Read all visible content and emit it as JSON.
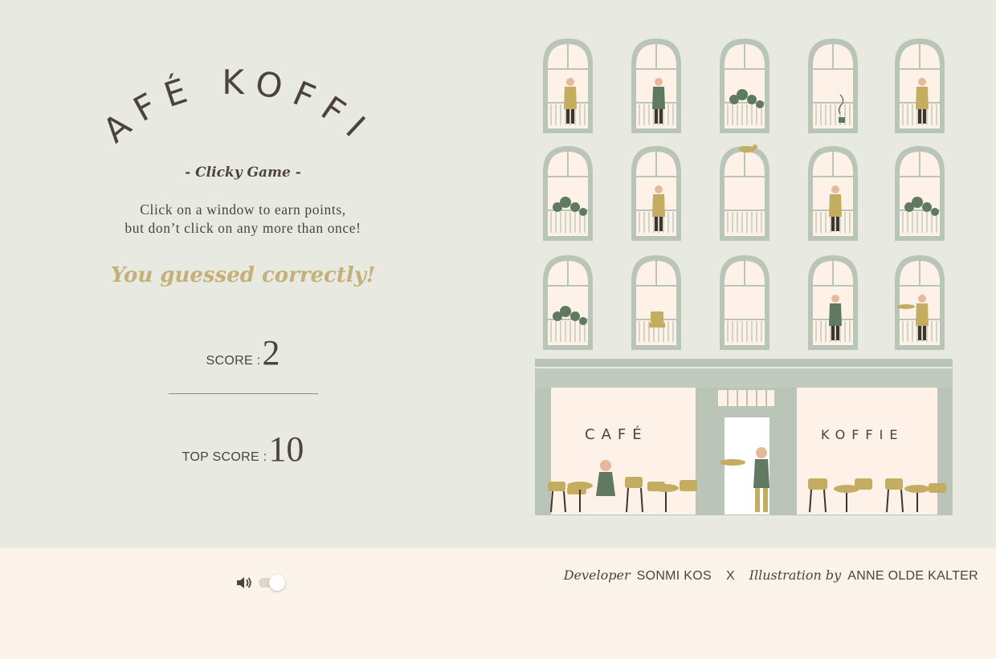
{
  "game": {
    "logo_text": "CAFÉ KOFFIE",
    "subtitle": "- Clicky Game -",
    "instructions_line1": "Click on a window to earn points,",
    "instructions_line2": "but don’t click on any more than once!",
    "feedback": "You guessed correctly!",
    "score_label": "SCORE :",
    "score_value": "2",
    "top_score_label": "TOP SCORE :",
    "top_score_value": "10"
  },
  "storefront": {
    "left_sign": "CAFÉ",
    "right_sign": "KOFFIE"
  },
  "windows": [
    {
      "row": 1,
      "col": 1,
      "content": "person-waving"
    },
    {
      "row": 1,
      "col": 2,
      "content": "person-at-table"
    },
    {
      "row": 1,
      "col": 3,
      "content": "plant"
    },
    {
      "row": 1,
      "col": 4,
      "content": "steaming-cup"
    },
    {
      "row": 1,
      "col": 5,
      "content": "person-with-cup"
    },
    {
      "row": 2,
      "col": 1,
      "content": "plant"
    },
    {
      "row": 2,
      "col": 2,
      "content": "person-watering"
    },
    {
      "row": 2,
      "col": 3,
      "content": "cat-on-roof"
    },
    {
      "row": 2,
      "col": 4,
      "content": "person-pouring"
    },
    {
      "row": 2,
      "col": 5,
      "content": "small-plant"
    },
    {
      "row": 3,
      "col": 1,
      "content": "plant"
    },
    {
      "row": 3,
      "col": 2,
      "content": "chair"
    },
    {
      "row": 3,
      "col": 3,
      "content": "empty"
    },
    {
      "row": 3,
      "col": 4,
      "content": "child"
    },
    {
      "row": 3,
      "col": 5,
      "content": "waiter-with-tray"
    }
  ],
  "footer": {
    "sound_icon": "speaker-icon",
    "sound_on": true,
    "developer_label": "Developer",
    "developer_name": "SONMI KOS",
    "separator": "X",
    "illustration_label": "Illustration by",
    "illustrator_name": "ANNE OLDE KALTER"
  },
  "colors": {
    "background": "#e8eae2",
    "footer_bg": "#fbf4ea",
    "text": "#4c433d",
    "accent": "#c5b07a",
    "sage": "#b9c6b7",
    "cream": "#fdf1e8",
    "mustard": "#c4ad61",
    "green": "#5f7a60"
  }
}
